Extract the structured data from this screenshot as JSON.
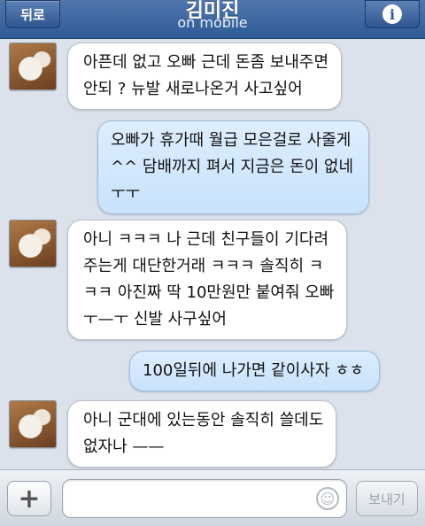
{
  "header": {
    "back_label": "뒤로",
    "title": "김미진",
    "subtitle": "on mobile",
    "info_glyph": "i"
  },
  "messages": [
    {
      "direction": "incoming",
      "text": "아픈데 없고 오빠 근데 돈좀 보내주면\n안되 ? 뉴발 새로나온거 사고싶어"
    },
    {
      "direction": "outgoing",
      "text": "오빠가 휴가때 월급 모은걸로 사줄게\n^^ 담배까지 펴서 지금은 돈이 없네\nㅜㅜ"
    },
    {
      "direction": "incoming",
      "text": "아니 ㅋㅋㅋ 나 근데 친구들이 기다려\n주는게 대단한거래 ㅋㅋㅋ 솔직히 ㅋ\nㅋㅋ 아진짜 딱 10만원만 붙여줘 오빠\nㅜ—ㅜ 신발 사구싶어"
    },
    {
      "direction": "outgoing",
      "text": "100일뒤에 나가면 같이사자 ㅎㅎ"
    },
    {
      "direction": "incoming",
      "text": "아니 군대에 있는동안 솔직히 쓸데도\n없자나 ——"
    }
  ],
  "composer": {
    "add_glyph": "+",
    "input_value": "",
    "emoji_glyph": "☺",
    "send_label": "보내기"
  },
  "icons": {
    "info": "info-icon",
    "add": "plus-icon",
    "emoji": "smiley-icon"
  },
  "colors": {
    "header": "#3a64a0",
    "incoming_bubble": "#ffffff",
    "outgoing_bubble": "#cfe6fc",
    "background": "#dbe2ec"
  }
}
